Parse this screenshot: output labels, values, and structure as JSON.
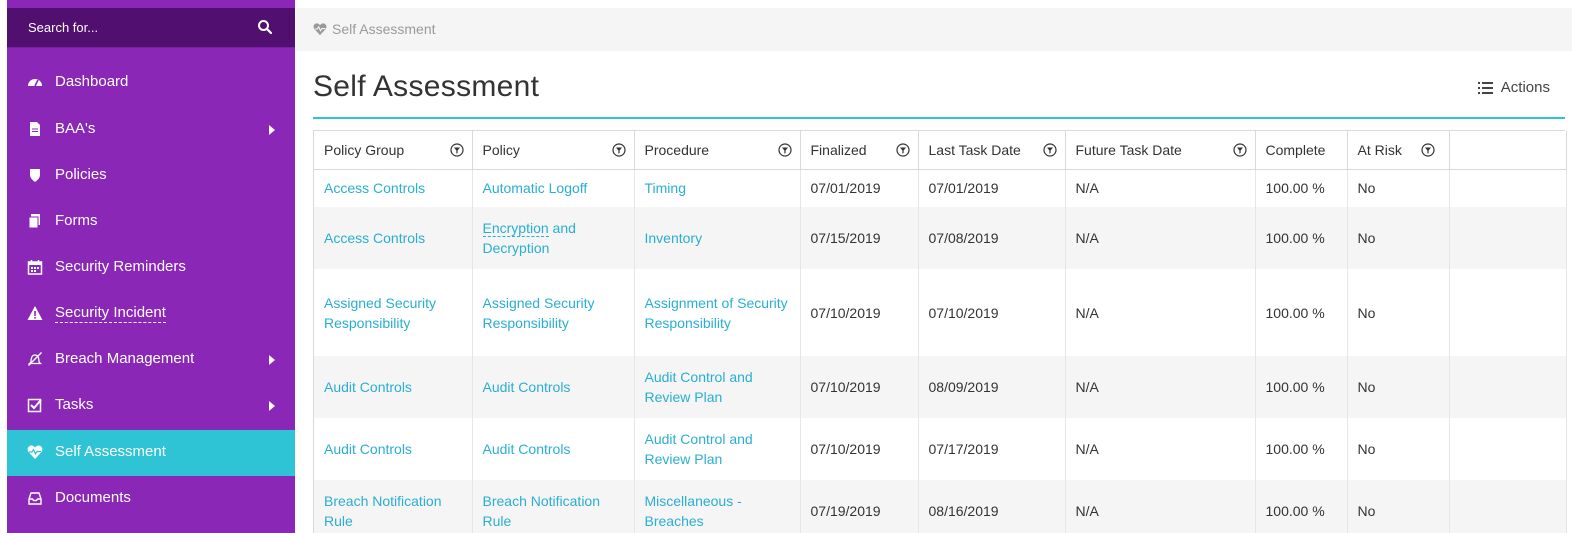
{
  "sidebar": {
    "search_placeholder": "Search for...",
    "items": [
      {
        "label": "Dashboard",
        "icon": "dashboard-icon",
        "has_submenu": false
      },
      {
        "label": "BAA's",
        "icon": "file-icon",
        "has_submenu": true
      },
      {
        "label": "Policies",
        "icon": "shield-icon",
        "has_submenu": false
      },
      {
        "label": "Forms",
        "icon": "copy-icon",
        "has_submenu": false
      },
      {
        "label": "Security Reminders",
        "icon": "calendar-icon",
        "has_submenu": false
      },
      {
        "label": "Security Incident",
        "icon": "warning-icon",
        "has_submenu": false
      },
      {
        "label": "Breach Management",
        "icon": "bell-slash-icon",
        "has_submenu": true
      },
      {
        "label": "Tasks",
        "icon": "check-square-icon",
        "has_submenu": true
      },
      {
        "label": "Self Assessment",
        "icon": "heartbeat-icon",
        "has_submenu": false,
        "active": true
      },
      {
        "label": "Documents",
        "icon": "inbox-icon",
        "has_submenu": false
      }
    ]
  },
  "breadcrumb": {
    "label": "Self Assessment"
  },
  "page": {
    "title": "Self Assessment",
    "actions_label": "Actions"
  },
  "table": {
    "columns": [
      "Policy Group",
      "Policy",
      "Procedure",
      "Finalized",
      "Last Task Date",
      "Future Task Date",
      "Complete",
      "At Risk"
    ],
    "rows": [
      {
        "policy_group": "Access Controls",
        "policy": "Automatic Logoff",
        "procedure": "Timing",
        "finalized": "07/01/2019",
        "last_task_date": "07/01/2019",
        "future_task_date": "N/A",
        "complete": "100.00 %",
        "at_risk": "No"
      },
      {
        "policy_group": "Access Controls",
        "policy_part1": "Encryption",
        "policy_part2": " and Decryption",
        "procedure": "Inventory",
        "finalized": "07/15/2019",
        "last_task_date": "07/08/2019",
        "future_task_date": "N/A",
        "complete": "100.00 %",
        "at_risk": "No"
      },
      {
        "policy_group": "Assigned Security Responsibility",
        "policy": "Assigned Security Responsibility",
        "procedure": "Assignment of Security Responsibility",
        "finalized": "07/10/2019",
        "last_task_date": "07/10/2019",
        "future_task_date": "N/A",
        "complete": "100.00 %",
        "at_risk": "No"
      },
      {
        "policy_group": "Audit Controls",
        "policy": "Audit Controls",
        "procedure": "Audit Control and Review Plan",
        "finalized": "07/10/2019",
        "last_task_date": "08/09/2019",
        "future_task_date": "N/A",
        "complete": "100.00 %",
        "at_risk": "No"
      },
      {
        "policy_group": "Audit Controls",
        "policy": "Audit Controls",
        "procedure": "Audit Control and Review Plan",
        "finalized": "07/10/2019",
        "last_task_date": "07/17/2019",
        "future_task_date": "N/A",
        "complete": "100.00 %",
        "at_risk": "No"
      },
      {
        "policy_group": "Breach Notification Rule",
        "policy": "Breach Notification Rule",
        "procedure": "Miscellaneous - Breaches",
        "finalized": "07/19/2019",
        "last_task_date": "08/16/2019",
        "future_task_date": "N/A",
        "complete": "100.00 %",
        "at_risk": "No"
      }
    ]
  }
}
